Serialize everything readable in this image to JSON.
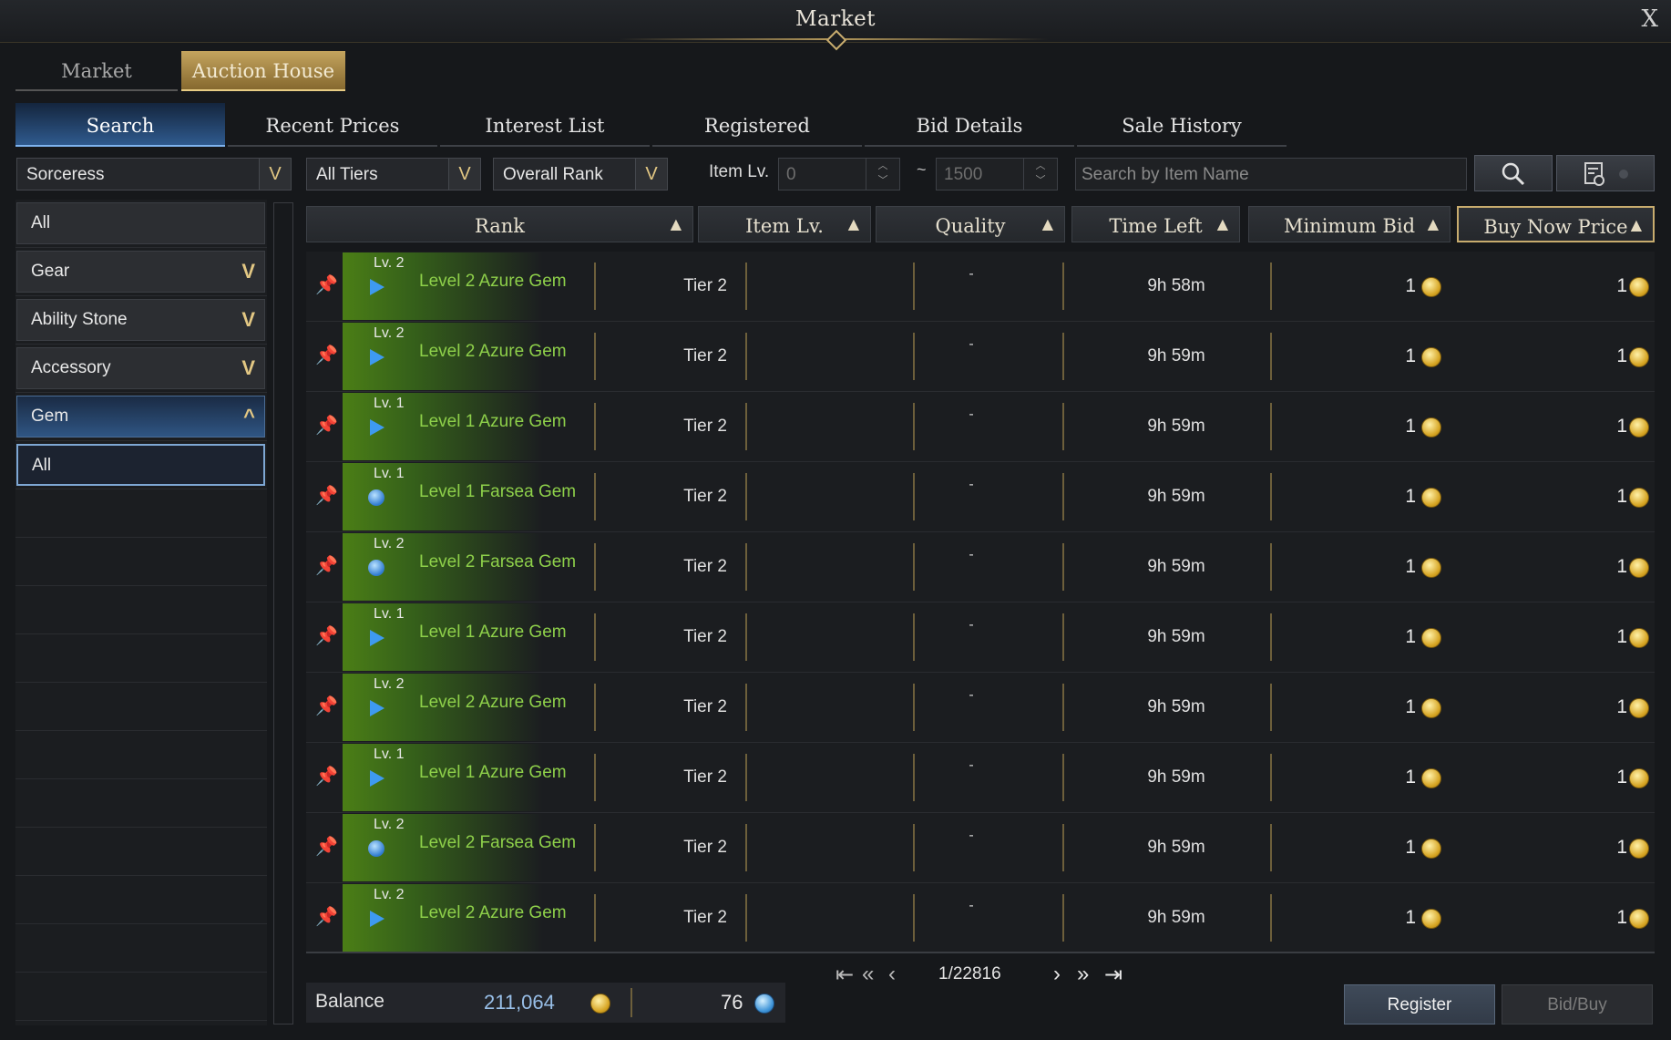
{
  "window": {
    "title": "Market",
    "close_label": "X"
  },
  "top_tabs": [
    {
      "label": "Market"
    },
    {
      "label": "Auction House",
      "active": true
    }
  ],
  "sub_tabs": [
    {
      "label": "Search",
      "active": true
    },
    {
      "label": "Recent Prices"
    },
    {
      "label": "Interest List"
    },
    {
      "label": "Registered"
    },
    {
      "label": "Bid Details"
    },
    {
      "label": "Sale History"
    }
  ],
  "filters": {
    "class": "Sorceress",
    "tier": "All Tiers",
    "rank": "Overall Rank",
    "item_lv_label": "Item Lv.",
    "item_lv_min": "0",
    "item_lv_max": "1500",
    "range_sep": "~",
    "search_placeholder": "Search by Item Name"
  },
  "sidebar": {
    "items": [
      {
        "label": "All"
      },
      {
        "label": "Gear",
        "chevron": "V"
      },
      {
        "label": "Ability Stone",
        "chevron": "V"
      },
      {
        "label": "Accessory",
        "chevron": "V"
      },
      {
        "label": "Gem",
        "chevron": "^",
        "open": true
      },
      {
        "label": "All",
        "sub": true
      }
    ]
  },
  "columns": [
    {
      "label": "Rank"
    },
    {
      "label": "Item Lv."
    },
    {
      "label": "Quality"
    },
    {
      "label": "Time Left"
    },
    {
      "label": "Minimum Bid"
    },
    {
      "label": "Buy Now Price",
      "selected": true
    }
  ],
  "sort_glyph": "▲",
  "rows": [
    {
      "lv": "Lv. 2",
      "name": "Level 2 Azure Gem",
      "gem": "azure",
      "tier": "Tier 2",
      "quality": "-",
      "time_left": "9h 58m",
      "min_bid": "1",
      "buy_now": "1"
    },
    {
      "lv": "Lv. 2",
      "name": "Level 2 Azure Gem",
      "gem": "azure",
      "tier": "Tier 2",
      "quality": "-",
      "time_left": "9h 59m",
      "min_bid": "1",
      "buy_now": "1"
    },
    {
      "lv": "Lv. 1",
      "name": "Level 1 Azure Gem",
      "gem": "azure",
      "tier": "Tier 2",
      "quality": "-",
      "time_left": "9h 59m",
      "min_bid": "1",
      "buy_now": "1"
    },
    {
      "lv": "Lv. 1",
      "name": "Level 1 Farsea Gem",
      "gem": "farsea",
      "tier": "Tier 2",
      "quality": "-",
      "time_left": "9h 59m",
      "min_bid": "1",
      "buy_now": "1"
    },
    {
      "lv": "Lv. 2",
      "name": "Level 2 Farsea Gem",
      "gem": "farsea",
      "tier": "Tier 2",
      "quality": "-",
      "time_left": "9h 59m",
      "min_bid": "1",
      "buy_now": "1"
    },
    {
      "lv": "Lv. 1",
      "name": "Level 1 Azure Gem",
      "gem": "azure",
      "tier": "Tier 2",
      "quality": "-",
      "time_left": "9h 59m",
      "min_bid": "1",
      "buy_now": "1"
    },
    {
      "lv": "Lv. 2",
      "name": "Level 2 Azure Gem",
      "gem": "azure",
      "tier": "Tier 2",
      "quality": "-",
      "time_left": "9h 59m",
      "min_bid": "1",
      "buy_now": "1"
    },
    {
      "lv": "Lv. 1",
      "name": "Level 1 Azure Gem",
      "gem": "azure",
      "tier": "Tier 2",
      "quality": "-",
      "time_left": "9h 59m",
      "min_bid": "1",
      "buy_now": "1"
    },
    {
      "lv": "Lv. 2",
      "name": "Level 2 Farsea Gem",
      "gem": "farsea",
      "tier": "Tier 2",
      "quality": "-",
      "time_left": "9h 59m",
      "min_bid": "1",
      "buy_now": "1"
    },
    {
      "lv": "Lv. 2",
      "name": "Level 2 Azure Gem",
      "gem": "azure",
      "tier": "Tier 2",
      "quality": "-",
      "time_left": "9h 59m",
      "min_bid": "1",
      "buy_now": "1"
    }
  ],
  "pagination": {
    "current": "1/22816"
  },
  "footer": {
    "balance_label": "Balance",
    "gold": "211,064",
    "blue_crystals": "76",
    "register_label": "Register",
    "bid_buy_label": "Bid/Buy"
  },
  "colors": {
    "accent_gold": "#c8ac6e",
    "item_name_green": "#8ed04a",
    "active_tab_blue": "#2f5a8e"
  }
}
